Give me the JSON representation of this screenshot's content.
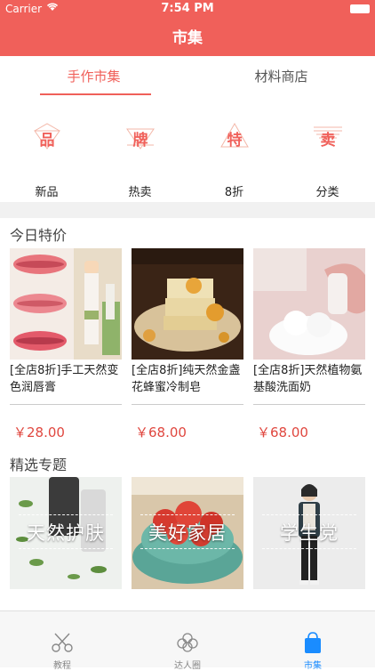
{
  "status_bar": {
    "carrier": "Carrier",
    "time": "7:54 PM"
  },
  "nav": {
    "title": "市集"
  },
  "tabs": [
    {
      "label": "手作市集",
      "active": true
    },
    {
      "label": "材料商店",
      "active": false
    }
  ],
  "quick_links": [
    {
      "glyph": "品",
      "label": "新品",
      "icon": "diamond-icon"
    },
    {
      "glyph": "牌",
      "label": "热卖",
      "icon": "triangle-icon"
    },
    {
      "glyph": "特",
      "label": "8折",
      "icon": "triangle-up-icon"
    },
    {
      "glyph": "卖",
      "label": "分类",
      "icon": "stripes-icon"
    }
  ],
  "today_deals": {
    "title": "今日特价",
    "products": [
      {
        "name": "[全店8折]手工天然变色润唇膏",
        "price": "￥28.00"
      },
      {
        "name": "[全店8折]纯天然金盏花蜂蜜冷制皂",
        "price": "￥68.00"
      },
      {
        "name": "[全店8折]天然植物氨基酸洗面奶",
        "price": "￥68.00"
      }
    ]
  },
  "topics": {
    "title": "精选专题",
    "items": [
      {
        "label": "天然护肤"
      },
      {
        "label": "美好家居"
      },
      {
        "label": "学生党"
      }
    ]
  },
  "tab_bar": [
    {
      "label": "教程",
      "icon": "scissors-icon",
      "active": false
    },
    {
      "label": "达人圈",
      "icon": "cotton-flower-icon",
      "active": false
    },
    {
      "label": "市集",
      "icon": "shopping-bag-icon",
      "active": true
    }
  ],
  "colors": {
    "accent": "#f0605a",
    "price": "#e0473f",
    "tab_active": "#1a8cff"
  }
}
